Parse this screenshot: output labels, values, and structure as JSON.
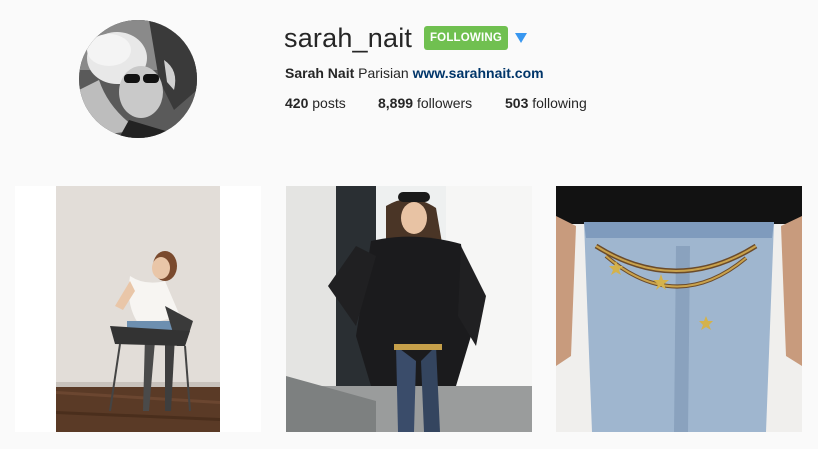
{
  "profile": {
    "username": "sarah_nait",
    "follow_button_label": "FOLLOWING",
    "dropdown_icon": "caret-down-icon",
    "full_name": "Sarah Nait",
    "bio": "Parisian",
    "website": "www.sarahnait.com",
    "posts_count": "420",
    "posts_label": "posts",
    "followers_count": "8,899",
    "followers_label": "followers",
    "following_count": "503",
    "following_label": "following"
  },
  "colors": {
    "follow_green": "#70c050",
    "link_blue": "#003569",
    "caret_blue": "#3897f0",
    "background": "#fafafa"
  }
}
